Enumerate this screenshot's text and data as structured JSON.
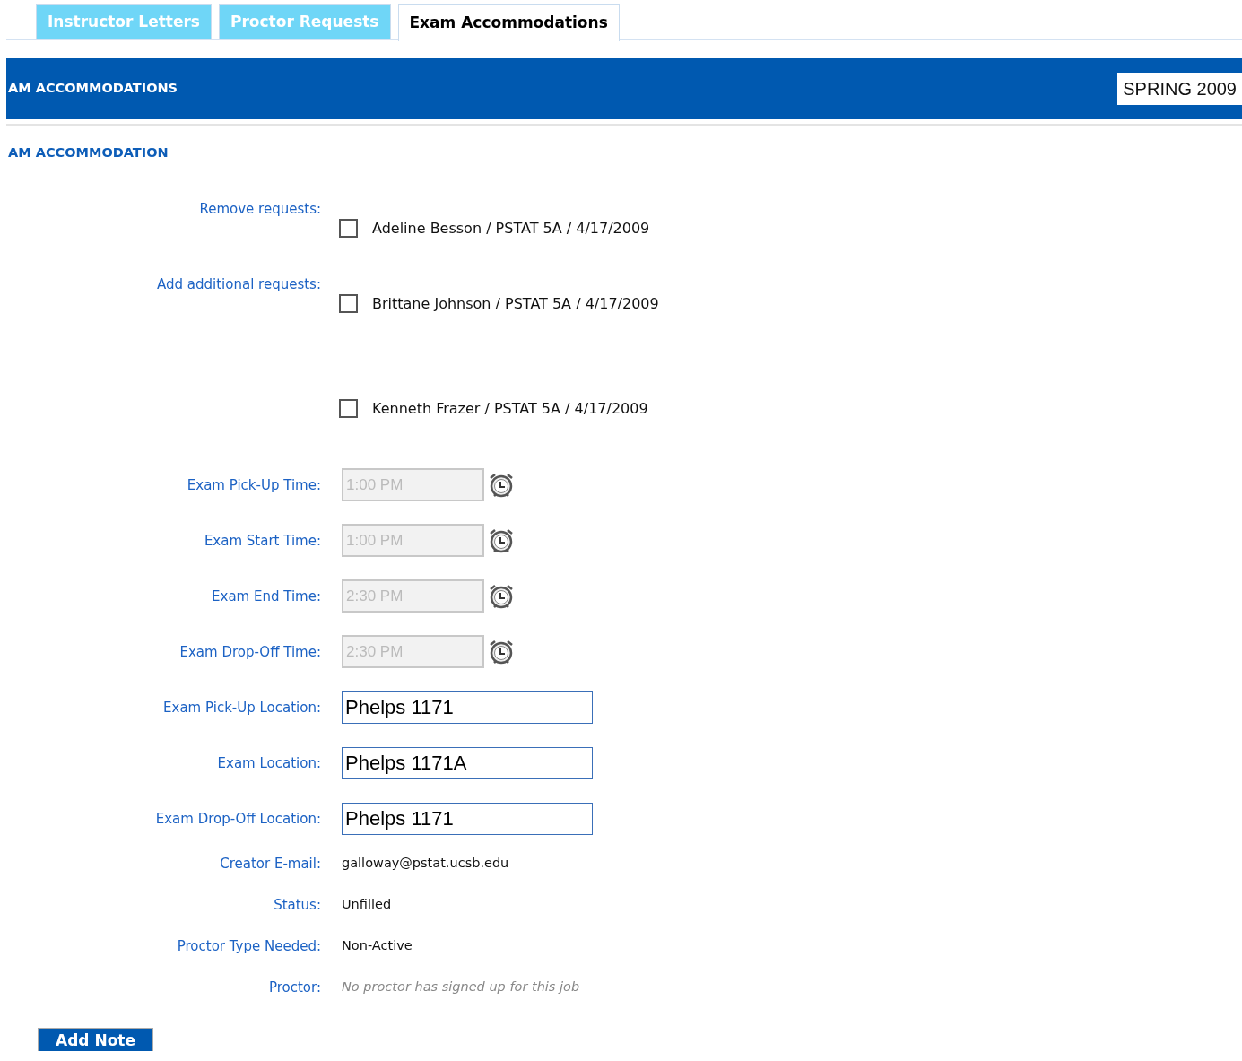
{
  "tabs": [
    {
      "label": "Instructor Letters",
      "selected": false
    },
    {
      "label": "Proctor Requests",
      "selected": false
    },
    {
      "label": "Exam Accommodations",
      "selected": true
    }
  ],
  "header": {
    "title": "AM ACCOMMODATIONS",
    "term": "SPRING 2009"
  },
  "section_title": "AM ACCOMMODATION",
  "request_labels": [
    "Remove requests:",
    "Add additional requests:"
  ],
  "requests": [
    {
      "label": "Adeline Besson / PSTAT 5A / 4/17/2009",
      "checked": false
    },
    {
      "label": "Brittane Johnson / PSTAT 5A / 4/17/2009",
      "checked": false
    },
    {
      "label": "Kenneth Frazer / PSTAT 5A / 4/17/2009",
      "checked": false
    }
  ],
  "fields": [
    {
      "kind": "time",
      "label": "Exam Pick-Up Time:",
      "value": "1:00 PM",
      "disabled": true
    },
    {
      "kind": "time",
      "label": "Exam Start Time:",
      "value": "1:00 PM",
      "disabled": true
    },
    {
      "kind": "time",
      "label": "Exam End Time:",
      "value": "2:30 PM",
      "disabled": true
    },
    {
      "kind": "time",
      "label": "Exam Drop-Off Time:",
      "value": "2:30 PM",
      "disabled": true
    },
    {
      "kind": "text",
      "label": "Exam Pick-Up Location:",
      "value": "Phelps 1171"
    },
    {
      "kind": "text",
      "label": "Exam Location:",
      "value": "Phelps 1171A"
    },
    {
      "kind": "text",
      "label": "Exam Drop-Off Location:",
      "value": "Phelps 1171"
    },
    {
      "kind": "static",
      "label": "Creator E-mail:",
      "value": "galloway@pstat.ucsb.edu"
    },
    {
      "kind": "static",
      "label": "Status:",
      "value": "Unfilled"
    },
    {
      "kind": "static",
      "label": "Proctor Type Needed:",
      "value": "Non-Active"
    },
    {
      "kind": "note",
      "label": "Proctor:",
      "value": "No proctor has signed up for this job"
    }
  ],
  "buttons": [
    "Add Note"
  ]
}
